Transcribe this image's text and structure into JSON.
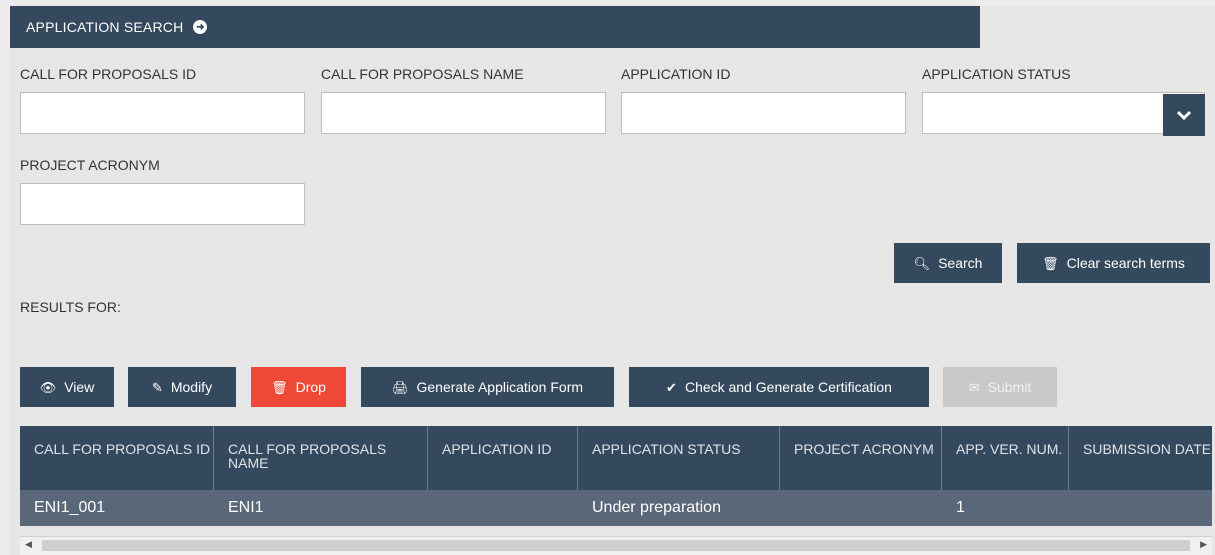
{
  "header": {
    "title": "APPLICATION SEARCH"
  },
  "form": {
    "cfp_id_label": "CALL FOR PROPOSALS ID",
    "cfp_name_label": "CALL FOR PROPOSALS NAME",
    "app_id_label": "APPLICATION ID",
    "app_status_label": "APPLICATION STATUS",
    "acronym_label": "PROJECT ACRONYM"
  },
  "search_actions": {
    "search": "Search",
    "clear": "Clear search terms"
  },
  "results_label": "RESULTS FOR:",
  "toolbar": {
    "view": "View",
    "modify": "Modify",
    "drop": "Drop",
    "generate_form": "Generate Application Form",
    "check_generate": "Check and Generate Certification",
    "submit": "Submit"
  },
  "table": {
    "columns": [
      "CALL FOR PROPOSALS ID",
      "CALL FOR PROPOSALS NAME",
      "APPLICATION ID",
      "APPLICATION STATUS",
      "PROJECT ACRONYM",
      "APP. VER. NUM.",
      "SUBMISSION DATE"
    ],
    "rows": [
      [
        "ENI1_001",
        "ENI1",
        "",
        "Under preparation",
        "",
        "1",
        ""
      ]
    ]
  },
  "colors": {
    "primary": "#34495e",
    "danger": "#ef4836",
    "row": "#5a6778"
  }
}
